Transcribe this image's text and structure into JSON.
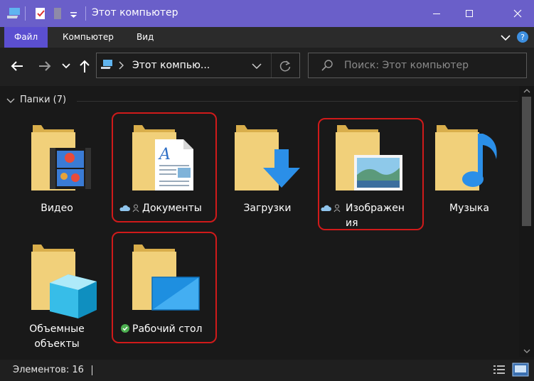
{
  "window": {
    "title": "Этот компьютер"
  },
  "ribbon": {
    "tabs": [
      {
        "label": "Файл",
        "active": true
      },
      {
        "label": "Компьютер",
        "active": false
      },
      {
        "label": "Вид",
        "active": false
      }
    ]
  },
  "navigation": {
    "address_text": "Этот компью...",
    "search_placeholder": "Поиск: Этот компьютер"
  },
  "group": {
    "header": "Папки (7)"
  },
  "folders": [
    {
      "label": "Видео"
    },
    {
      "label": "Документы"
    },
    {
      "label": "Загрузки"
    },
    {
      "label_line1": "Изображен",
      "label_line2": "ия"
    },
    {
      "label": "Музыка"
    },
    {
      "label_line1": "Объемные",
      "label_line2": "объекты"
    },
    {
      "label": "Рабочий стол"
    }
  ],
  "status": {
    "items_text": "Элементов: 16"
  },
  "colors": {
    "titlebar": "#6a5fc9",
    "active_tab": "#5b4fd0",
    "highlight": "#d01a1a",
    "folder": "#f1d07a"
  }
}
